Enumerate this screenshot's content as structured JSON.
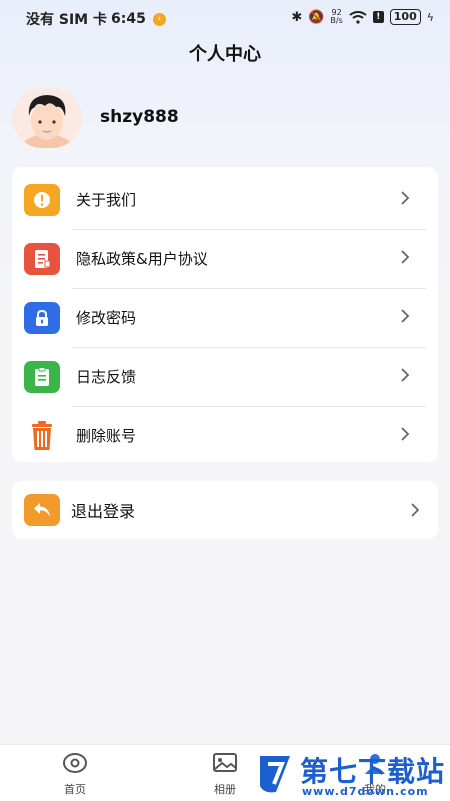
{
  "status_bar": {
    "carrier": "没有 SIM 卡",
    "time": "6:45",
    "network_speed_top": "92",
    "network_speed_bottom": "B/s",
    "battery": "100"
  },
  "header": {
    "title": "个人中心"
  },
  "profile": {
    "username": "shzy888",
    "avatar": "avatar-icon"
  },
  "menu": {
    "items": [
      {
        "label": "关于我们",
        "icon": "info-icon",
        "color": "#f5a623"
      },
      {
        "label": "隐私政策&用户协议",
        "icon": "document-icon",
        "color": "#e8533f"
      },
      {
        "label": "修改密码",
        "icon": "lock-icon",
        "color": "#2f6de6"
      },
      {
        "label": "日志反馈",
        "icon": "clipboard-icon",
        "color": "#3bb54a"
      },
      {
        "label": "删除账号",
        "icon": "trash-icon",
        "color": "#ee6a1f"
      }
    ]
  },
  "logout": {
    "label": "退出登录",
    "icon": "back-arrow-icon",
    "color": "#f39a2d"
  },
  "bottom_nav": {
    "items": [
      {
        "label": "首页",
        "icon": "home-icon"
      },
      {
        "label": "相册",
        "icon": "album-icon"
      },
      {
        "label": "我的",
        "icon": "profile-icon"
      }
    ]
  },
  "watermark": {
    "text": "第七下载站",
    "url": "www.d7down.com"
  }
}
